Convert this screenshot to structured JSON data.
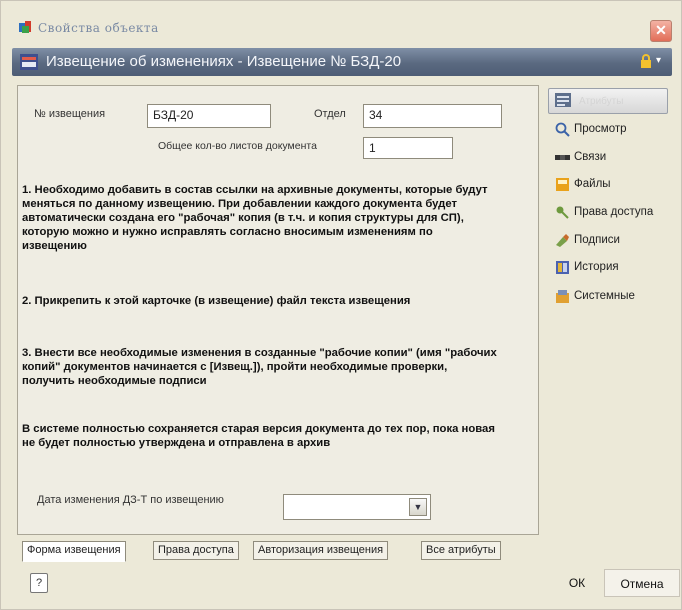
{
  "window": {
    "title": "Свойства объекта",
    "close_glyph": "✕"
  },
  "header": {
    "title": "Извещение об изменениях - Извещение № БЗД-20",
    "menu_glyph": "▾"
  },
  "form": {
    "notice_number_label": "№ извещения",
    "notice_number_value": "БЗД-20",
    "department_label": "Отдел",
    "department_value": "34",
    "sheets_label": "Общее кол-во листов документа",
    "sheets_value": "1",
    "instruction_1": "1. Необходимо добавить в состав ссылки на архивные документы, которые будут меняться по данному извещению. При добавлении каждого документа будет автоматически создана его \"рабочая\" копия (в т.ч. и копия структуры для СП), которую можно и нужно исправлять согласно вносимым изменениям по извещению",
    "instruction_2": "2. Прикрепить к этой карточке (в извещение) файл текста извещения",
    "instruction_3": "3. Внести все необходимые изменения в созданные \"рабочие копии\" (имя \"рабочих копий\" документов начинается с [Извещ.]), пройти необходимые проверки, получить необходимые подписи",
    "instruction_4": "В системе полностью сохраняется старая версия документа до тех пор, пока новая не будет полностью утверждена и отправлена в архив",
    "date_label": "Дата изменения ДЗ-Т по извещению",
    "date_value": ""
  },
  "tabs": [
    {
      "label": "Форма извещения",
      "active": true
    },
    {
      "label": "Права доступа",
      "active": false
    },
    {
      "label": "Авторизация извещения",
      "active": false
    },
    {
      "label": "Все атрибуты",
      "active": false
    }
  ],
  "sidebar": {
    "top_button": {
      "label": "Атрибуты",
      "icon": "attributes-icon"
    },
    "items": [
      {
        "label": "Просмотр",
        "icon": "magnifier-icon"
      },
      {
        "label": "Связи",
        "icon": "links-icon"
      },
      {
        "label": "Файлы",
        "icon": "files-icon"
      },
      {
        "label": "Права доступа",
        "icon": "key-icon"
      },
      {
        "label": "Подписи",
        "icon": "signature-icon"
      },
      {
        "label": "История",
        "icon": "history-icon"
      },
      {
        "label": "Системные",
        "icon": "system-icon"
      }
    ]
  },
  "footer": {
    "help_glyph": "?",
    "ok_label": "ОК",
    "cancel_label": "Отмена"
  },
  "colors": {
    "accent_red": "#c8141e",
    "header_blue": "#5a6980",
    "background": "#ece9d8"
  }
}
